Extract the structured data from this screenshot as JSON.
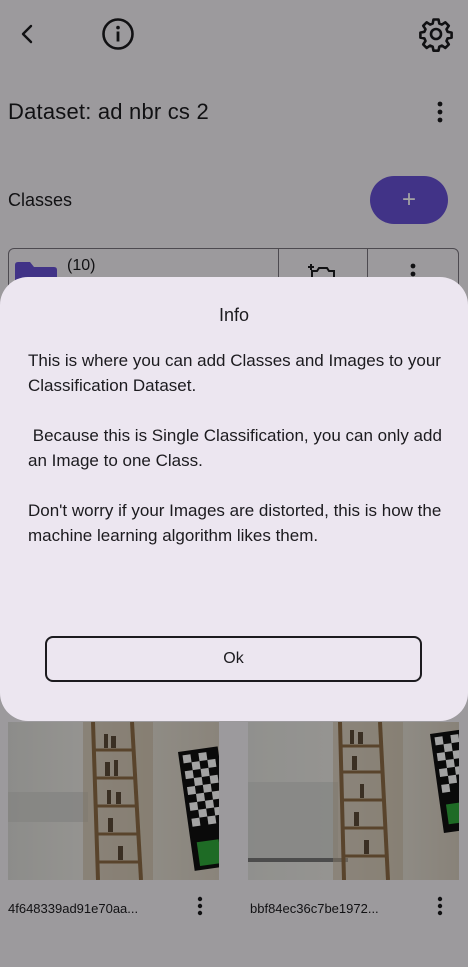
{
  "appbar": {
    "back_icon": "chevron-left-icon",
    "info_icon": "info-circle-icon",
    "settings_icon": "gear-icon"
  },
  "dataset": {
    "title": "Dataset: ad nbr cs 2"
  },
  "classes": {
    "label": "Classes",
    "add_label": "+",
    "items": [
      {
        "count": "(10)"
      }
    ]
  },
  "images": [
    {
      "filename": "4f648339ad91e70aa..."
    },
    {
      "filename": "bbf84ec36c7be1972..."
    }
  ],
  "dialog": {
    "title": "Info",
    "paragraphs": [
      "This is where you can add Classes and Images to your Classification Dataset.",
      " Because this is Single Classification, you can only add an Image to one Class.",
      "Don't worry if your Images are distorted, this is how the machine learning algorithm likes them."
    ],
    "ok_label": "Ok"
  },
  "colors": {
    "accent": "#6750d4",
    "dialog_bg": "#ece6f0",
    "scrim": "rgba(0,0,0,0.36)",
    "screen_bg": "#f4f1f6"
  }
}
